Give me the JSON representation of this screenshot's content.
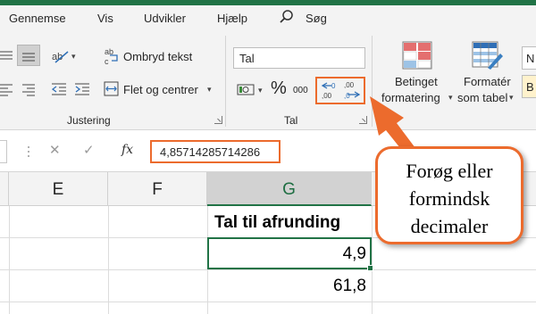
{
  "menu": {
    "tabs": [
      "Gennemse",
      "Vis",
      "Udvikler",
      "Hjælp"
    ],
    "search_label": "Søg"
  },
  "ribbon": {
    "alignment": {
      "wrap_text_label": "Ombryd tekst",
      "merge_center_label": "Flet og centrer",
      "group_label": "Justering"
    },
    "number": {
      "format_value": "Tal",
      "percent_label": "%",
      "thousands_label": "000",
      "group_label": "Tal"
    },
    "styles": {
      "conditional_formatting_label_1": "Betinget",
      "conditional_formatting_label_2": "formatering",
      "format_as_table_label_1": "Formatér",
      "format_as_table_label_2": "som tabel",
      "style_box_1": "N",
      "style_box_2": "B"
    }
  },
  "formula_bar": {
    "cancel_symbol": "✕",
    "enter_symbol": "✓",
    "fx_label": "fx",
    "value": "4,85714285714286"
  },
  "columns": [
    {
      "label": "E",
      "selected": false
    },
    {
      "label": "F",
      "selected": false
    },
    {
      "label": "G",
      "selected": true
    }
  ],
  "cells": {
    "header": "Tal til afrunding",
    "row1": "4,9",
    "row2": "61,8"
  },
  "callout": {
    "line1": "Forøg eller",
    "line2": "formindsk",
    "line3": "decimaler"
  },
  "colors": {
    "accent_green": "#217346",
    "highlight_orange": "#ec6b2d"
  }
}
